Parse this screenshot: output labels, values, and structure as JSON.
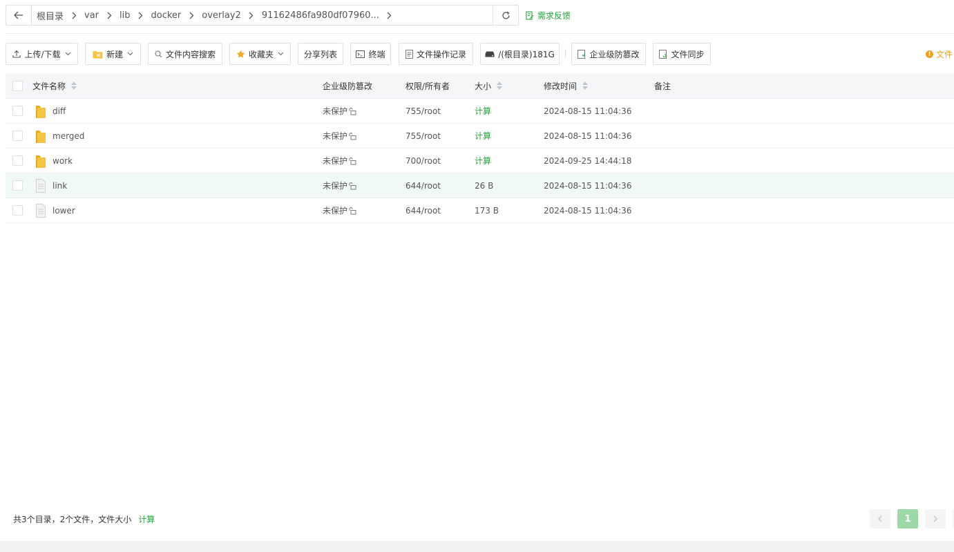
{
  "breadcrumbs": [
    "根目录",
    "var",
    "lib",
    "docker",
    "overlay2",
    "91162486fa980df07960..."
  ],
  "feedback_label": "需求反馈",
  "toolbar": {
    "upload_label": "上传/下载",
    "new_label": "新建",
    "search_content_label": "文件内容搜索",
    "favorites_label": "收藏夹",
    "share_list_label": "分享列表",
    "terminal_label": "终端",
    "op_log_label": "文件操作记录",
    "disk_label": "/(根目录)181G",
    "tamper_label": "企业级防篡改",
    "sync_label": "文件同步"
  },
  "right_notice": "文件",
  "table": {
    "headers": {
      "name": "文件名称",
      "tamper": "企业级防篡改",
      "perm": "权限/所有者",
      "size": "大小",
      "mtime": "修改时间",
      "note": "备注"
    },
    "rows": [
      {
        "type": "folder",
        "name": "diff",
        "tamper": "未保护",
        "perm": "755/root",
        "size": "计算",
        "mtime": "2024-08-15 11:04:36",
        "note": ""
      },
      {
        "type": "folder",
        "name": "merged",
        "tamper": "未保护",
        "perm": "755/root",
        "size": "计算",
        "mtime": "2024-08-15 11:04:36",
        "note": ""
      },
      {
        "type": "folder",
        "name": "work",
        "tamper": "未保护",
        "perm": "700/root",
        "size": "计算",
        "mtime": "2024-09-25 14:44:18",
        "note": ""
      },
      {
        "type": "file",
        "name": "link",
        "tamper": "未保护",
        "perm": "644/root",
        "size": "26 B",
        "mtime": "2024-08-15 11:04:36",
        "note": ""
      },
      {
        "type": "file",
        "name": "lower",
        "tamper": "未保护",
        "perm": "644/root",
        "size": "173 B",
        "mtime": "2024-08-15 11:04:36",
        "note": ""
      }
    ]
  },
  "footer": {
    "summary": "共3个目录，2个文件，文件大小",
    "calc_label": "计算"
  },
  "pagination": {
    "current_page": "1"
  },
  "colors": {
    "accent_green": "#20a53a",
    "folder_yellow": "#f7c342",
    "warning_orange": "#f0a020"
  }
}
